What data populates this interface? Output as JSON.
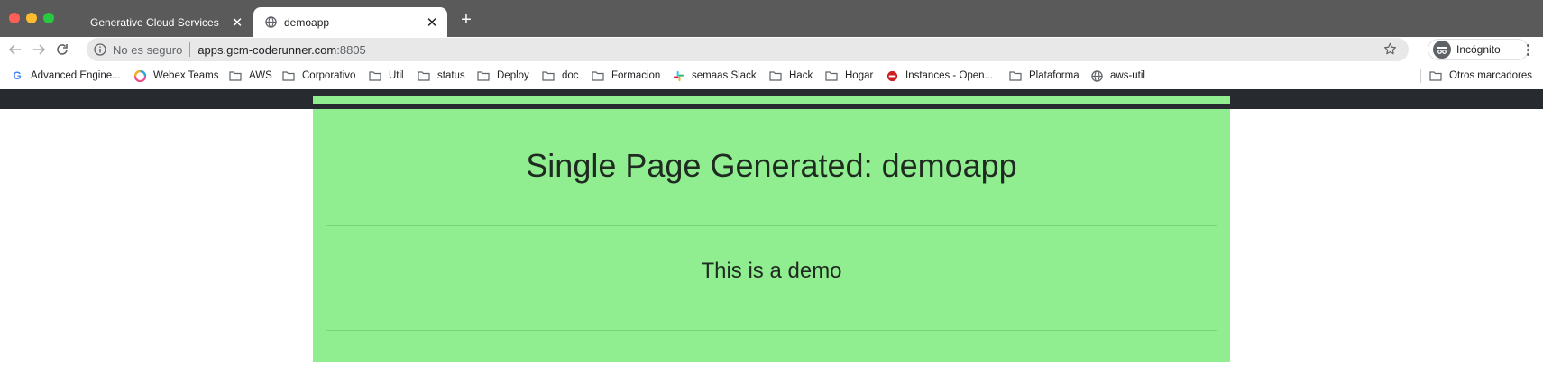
{
  "browser": {
    "tabs": [
      {
        "title": "Generative Cloud Services",
        "active": false
      },
      {
        "title": "demoapp",
        "active": true
      }
    ],
    "new_tab_label": "+",
    "address": {
      "security_text": "No es seguro",
      "host": "apps.gcm-coderunner.com",
      "port": ":8805"
    },
    "profile_label": "Incógnito",
    "bookmarks": [
      {
        "label": "Advanced Engine...",
        "icon": "google-icon"
      },
      {
        "label": "Webex Teams",
        "icon": "webex-icon"
      },
      {
        "label": "AWS",
        "icon": "folder-icon"
      },
      {
        "label": "Corporativo",
        "icon": "folder-icon"
      },
      {
        "label": "Util",
        "icon": "folder-icon"
      },
      {
        "label": "status",
        "icon": "folder-icon"
      },
      {
        "label": "Deploy",
        "icon": "folder-icon"
      },
      {
        "label": "doc",
        "icon": "folder-icon"
      },
      {
        "label": "Formacion",
        "icon": "folder-icon"
      },
      {
        "label": "semaas Slack",
        "icon": "slack-icon"
      },
      {
        "label": "Hack",
        "icon": "folder-icon"
      },
      {
        "label": "Hogar",
        "icon": "folder-icon"
      },
      {
        "label": "Instances - Open...",
        "icon": "openstack-icon"
      },
      {
        "label": "Plataforma",
        "icon": "folder-icon"
      },
      {
        "label": "aws-util",
        "icon": "globe-icon"
      }
    ],
    "other_bookmarks": "Otros marcadores"
  },
  "page": {
    "heading": "Single Page Generated: demoapp",
    "text": "This is a demo",
    "accent_color": "#90ee90",
    "navbar_color": "#272b30"
  }
}
